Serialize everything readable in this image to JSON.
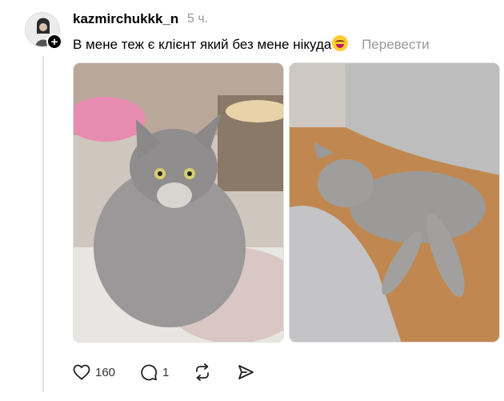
{
  "post": {
    "username": "kazmirchukkk_n",
    "time": "5 ч.",
    "text": "В мене теж є клієнт який без мене нікуда",
    "emoji": "crazy-face-emoji",
    "translate_label": "Перевести"
  },
  "actions": {
    "likes": "160",
    "comments": "1"
  },
  "colors": {
    "muted": "#999999",
    "text": "#000000",
    "thread_line": "#e3e3e3"
  },
  "icons": [
    "plus-icon",
    "heart-icon",
    "comment-icon",
    "repost-icon",
    "share-icon"
  ]
}
